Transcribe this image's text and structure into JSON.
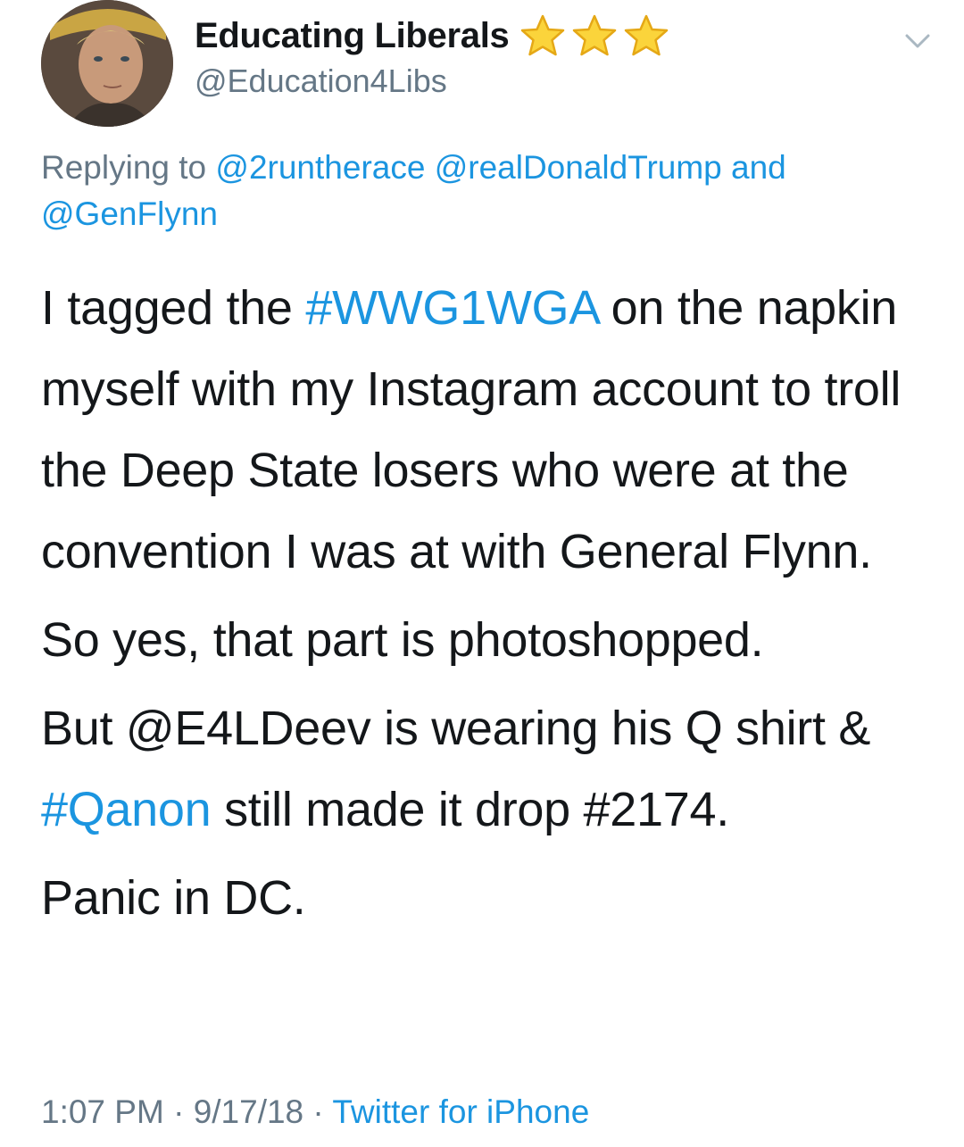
{
  "author": {
    "display_name": "Educating Liberals",
    "handle": "@Education4Libs",
    "badge_icons": [
      "star-icon",
      "star-icon",
      "star-icon"
    ],
    "badge_color": "#f5c518"
  },
  "menu": {
    "icon": "chevron-down-icon"
  },
  "reply": {
    "prefix": "Replying to",
    "mention_1": "@2runtherace",
    "mention_2": "@realDonaldTrump",
    "conjunction": "and",
    "mention_3": "@GenFlynn"
  },
  "tweet": {
    "p1_a": "I tagged the ",
    "p1_hashtag": "#WWG1WGA",
    "p1_b": " on the napkin myself with my Instagram account to troll the Deep State losers who were at the convention I was at with General Flynn.",
    "p2": "So yes, that part is photoshopped.",
    "p3_a": "But @E4LDeev is wearing his Q shirt & ",
    "p3_hashtag": "#Qanon",
    "p3_b": " still made it drop #2174.",
    "p4": "Panic in DC."
  },
  "meta": {
    "time": "1:07 PM",
    "separator": " · ",
    "date": "9/17/18",
    "source": "Twitter for iPhone"
  },
  "colors": {
    "link": "#1b95e0",
    "secondary": "#657786",
    "text": "#14171a"
  }
}
